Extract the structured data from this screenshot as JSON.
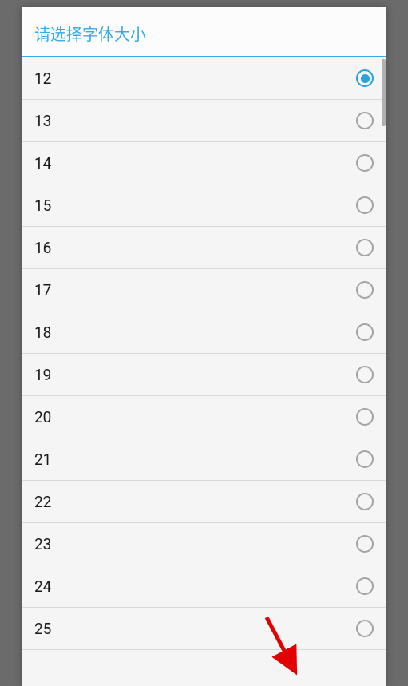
{
  "dialog": {
    "title": "请选择字体大小",
    "options": [
      {
        "label": "12",
        "selected": true
      },
      {
        "label": "13",
        "selected": false
      },
      {
        "label": "14",
        "selected": false
      },
      {
        "label": "15",
        "selected": false
      },
      {
        "label": "16",
        "selected": false
      },
      {
        "label": "17",
        "selected": false
      },
      {
        "label": "18",
        "selected": false
      },
      {
        "label": "19",
        "selected": false
      },
      {
        "label": "20",
        "selected": false
      },
      {
        "label": "21",
        "selected": false
      },
      {
        "label": "22",
        "selected": false
      },
      {
        "label": "23",
        "selected": false
      },
      {
        "label": "24",
        "selected": false
      },
      {
        "label": "25",
        "selected": false
      }
    ]
  }
}
